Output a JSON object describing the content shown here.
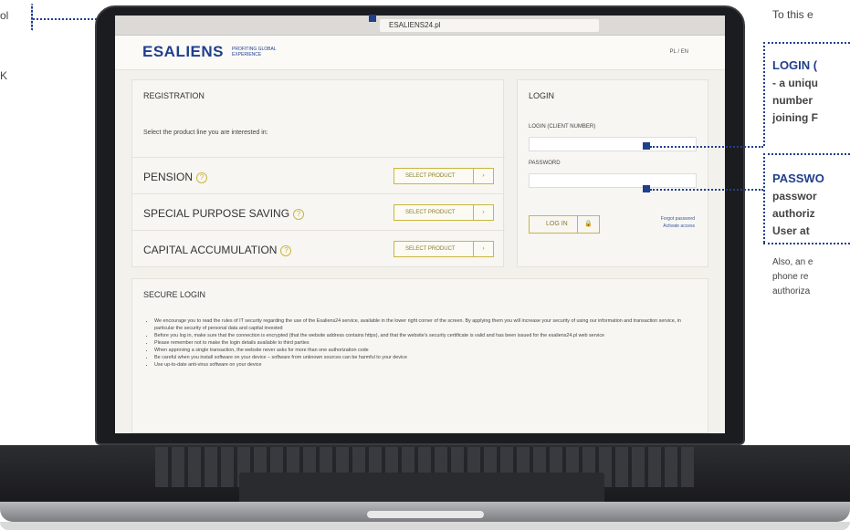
{
  "browser": {
    "url": "ESALIENS24.pl"
  },
  "site": {
    "logo": "ESALIENS",
    "tagline": "PROFITING GLOBAL EXPERIENCE",
    "lang": "PL / EN"
  },
  "registration": {
    "title": "REGISTRATION",
    "subtitle": "Select the product line you are interested in:",
    "products": [
      {
        "name": "PENSION",
        "button": "SELECT PRODUCT"
      },
      {
        "name": "SPECIAL PURPOSE SAVING",
        "button": "SELECT PRODUCT"
      },
      {
        "name": "CAPITAL ACCUMULATION",
        "button": "SELECT PRODUCT"
      }
    ]
  },
  "login": {
    "title": "LOGIN",
    "login_label": "LOGIN (CLIENT NUMBER)",
    "password_label": "PASSWORD",
    "button": "LOG IN",
    "forgot": "Forgot password",
    "activate": "Activate access"
  },
  "secure": {
    "title": "SECURE LOGIN",
    "items": [
      "We encourage you to read the rules of IT security regarding the use of the Esaliens24 service, available in the lower right corner of the screen. By applying them you will increase your security of using our information and transaction service, in particular the security of personal data and capital invested",
      "Before you log in, make sure that the connection is encrypted (that the website address contains https), and that the website's security certificate is valid and has been issued for the esaliens24.pl web service",
      "Please remember not to make the login details available to third parties",
      "When approving a single transaction, the website never asks for more than one authorization code",
      "Be careful when you install software on your device – software from unknown sources can be harmful to your device",
      "Use up-to-date anti-virus software on your device"
    ]
  },
  "callouts": {
    "left_top": "ol",
    "left_mid": "K",
    "right_intro": "To this e",
    "login_head": "LOGIN (",
    "login_body": [
      "- a uniqu",
      "number",
      "joining F"
    ],
    "password_head": "PASSWO",
    "password_body": [
      "passwor",
      "authoriz",
      "User at"
    ],
    "footer": [
      "Also, an e",
      "phone re",
      "authoriza"
    ]
  }
}
